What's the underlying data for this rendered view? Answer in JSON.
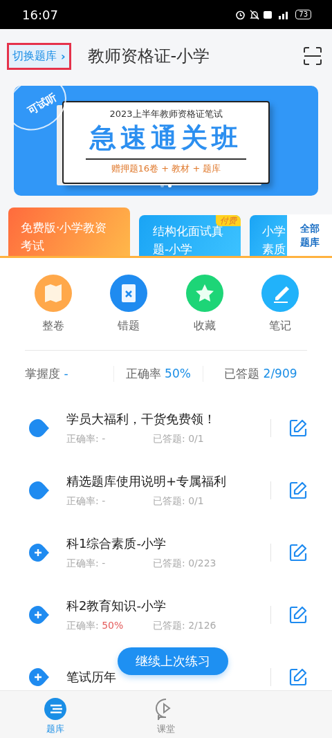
{
  "status_bar": {
    "time": "16:07",
    "battery": "73"
  },
  "header": {
    "switch_label": "切换题库",
    "switch_arrow": "›",
    "highlighted": true,
    "title": "教师资格证-小学"
  },
  "banner": {
    "badge": "可试听",
    "subtitle": "2023上半年教师资格证笔试",
    "headline": "急速通关班",
    "offer": "赠押题16卷 + 教材 + 题库",
    "dots": [
      {
        "selected": false
      },
      {
        "selected": true
      }
    ]
  },
  "courses": [
    {
      "title": "免费版·小学教资考试",
      "kind": "free"
    },
    {
      "title": "结构化面试真题-小学",
      "kind": "paid",
      "tag": "付费"
    },
    {
      "title": "小学素质",
      "kind": "partial"
    }
  ],
  "all_banks": "全部题库",
  "tools": [
    {
      "label": "整卷",
      "kind": "paper"
    },
    {
      "label": "错题",
      "kind": "wrong"
    },
    {
      "label": "收藏",
      "kind": "star"
    },
    {
      "label": "笔记",
      "kind": "note"
    }
  ],
  "stats": [
    {
      "label": "掌握度",
      "value": "-"
    },
    {
      "label": "正确率",
      "value": "50%"
    },
    {
      "label": "已答题",
      "value": "2/909"
    }
  ],
  "chapters": [
    {
      "title": "学员大福利，干货免费领！",
      "expandable": false,
      "accuracy_label": "正确率:",
      "accuracy": "-",
      "accuracy_alert": false,
      "answered": "已答题: 0/1"
    },
    {
      "title": "精选题库使用说明+专属福利",
      "expandable": false,
      "accuracy_label": "正确率:",
      "accuracy": "-",
      "accuracy_alert": false,
      "answered": "已答题: 0/1"
    },
    {
      "title": "科1综合素质-小学",
      "expandable": true,
      "accuracy_label": "正确率:",
      "accuracy": "-",
      "accuracy_alert": false,
      "answered": "已答题: 0/223"
    },
    {
      "title": "科2教育知识-小学",
      "expandable": true,
      "accuracy_label": "正确率:",
      "accuracy": "50%",
      "accuracy_alert": true,
      "answered": "已答题: 2/126"
    },
    {
      "title": "笔试历年",
      "expandable": true
    }
  ],
  "continue_button": "继续上次练习",
  "nav": [
    {
      "label": "题库",
      "kind": "bank",
      "selected": true
    },
    {
      "label": "课堂",
      "kind": "class",
      "selected": false
    }
  ]
}
